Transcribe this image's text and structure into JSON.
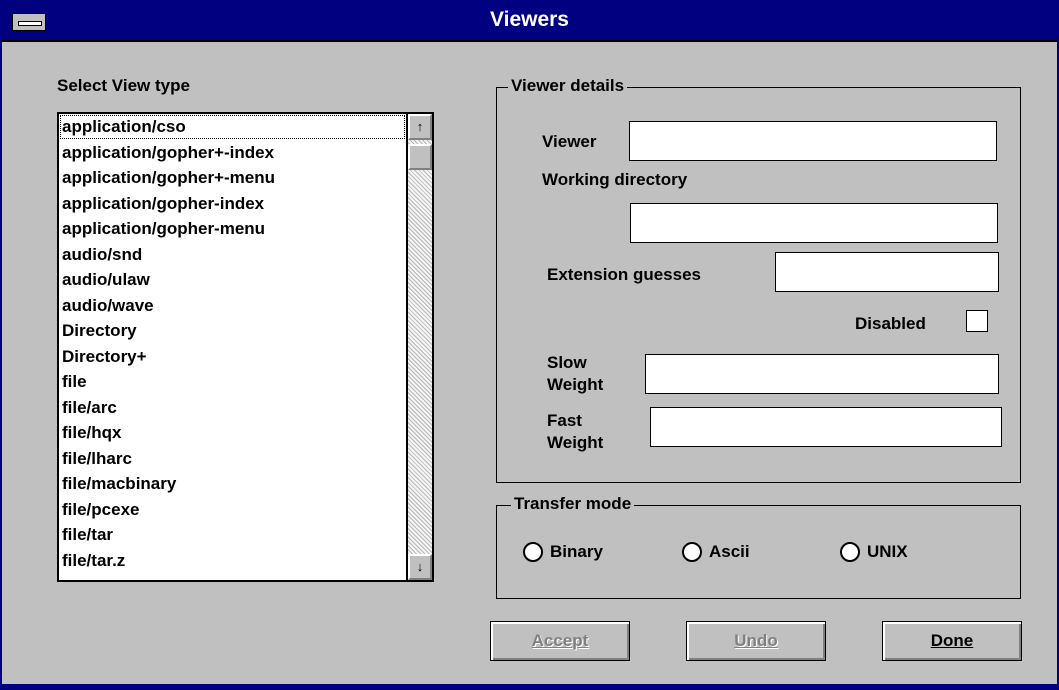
{
  "window": {
    "title": "Viewers"
  },
  "view_type": {
    "label": "Select View type",
    "items": [
      "application/cso",
      "application/gopher+-index",
      "application/gopher+-menu",
      "application/gopher-index",
      "application/gopher-menu",
      "audio/snd",
      "audio/ulaw",
      "audio/wave",
      "Directory",
      "Directory+",
      "file",
      "file/arc",
      "file/hqx",
      "file/lharc",
      "file/macbinary",
      "file/pcexe",
      "file/tar",
      "file/tar.z"
    ],
    "scroll_up_glyph": "↑",
    "scroll_down_glyph": "↓"
  },
  "viewer_details": {
    "group_label": "Viewer details",
    "viewer_label": "Viewer",
    "viewer_value": "",
    "working_dir_label": "Working directory",
    "working_dir_value": "",
    "extension_label": "Extension guesses",
    "extension_value": "",
    "disabled_label": "Disabled",
    "disabled_checked": false,
    "slow_label_1": "Slow",
    "slow_label_2": "Weight",
    "slow_value": "",
    "fast_label_1": "Fast",
    "fast_label_2": "Weight",
    "fast_value": ""
  },
  "transfer_mode": {
    "group_label": "Transfer mode",
    "options": [
      "Binary",
      "Ascii",
      "UNIX"
    ]
  },
  "buttons": {
    "accept": "Accept",
    "undo": "Undo",
    "done": "Done"
  }
}
